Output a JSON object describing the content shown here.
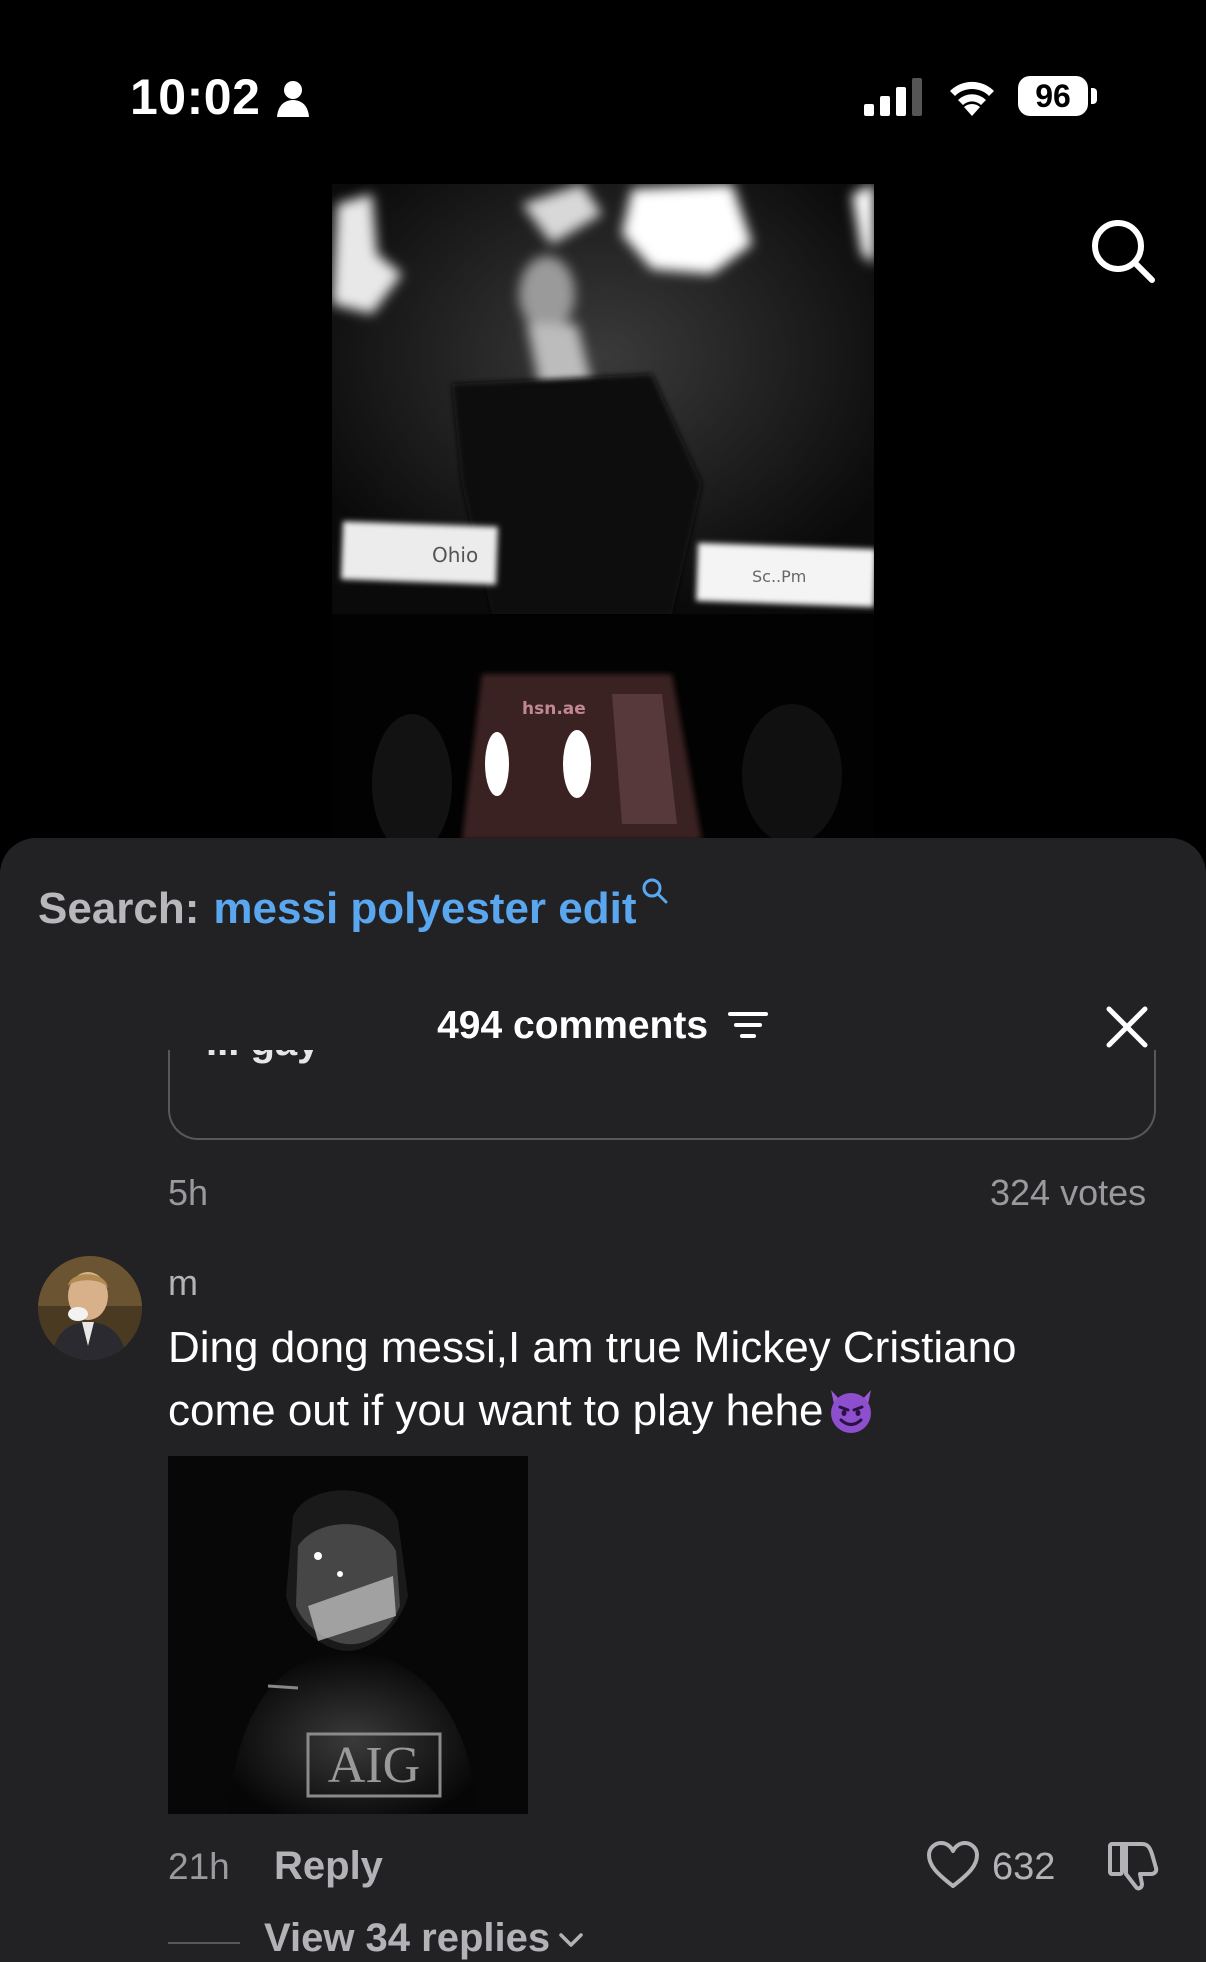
{
  "status_bar": {
    "time": "10:02",
    "battery": "96"
  },
  "video": {
    "watermark": "hsn.ae"
  },
  "sheet": {
    "search_label": "Search:",
    "search_query": "messi polyester edit",
    "comments_count": "494 comments"
  },
  "poll": {
    "partial_text": "... gay",
    "time": "5h",
    "votes": "324 votes"
  },
  "comment": {
    "username": "m",
    "text": "Ding dong messi,I am true Mickey Cristiano come out if you want to play hehe",
    "emoji": "smiling-face-with-horns",
    "image_label": "AIG",
    "time": "21h",
    "reply_label": "Reply",
    "likes": "632",
    "view_replies": "View 34 replies"
  },
  "colors": {
    "accent_link": "#5aa7f0",
    "sheet_bg": "#222224",
    "muted_text": "#9a9a9e"
  }
}
